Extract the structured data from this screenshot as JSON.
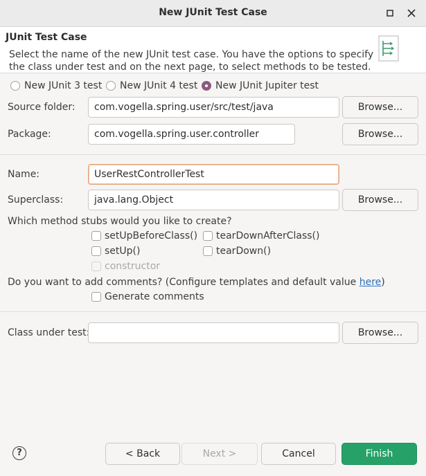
{
  "window": {
    "title": "New JUnit Test Case",
    "minimize_icon": "minimize-icon",
    "close_icon": "close-icon"
  },
  "header": {
    "title": "JUnit Test Case",
    "description_line1": "Select the name of the new JUnit test case. You have the options to specify",
    "description_line2": "the class under test and on the next page, to select methods to be tested.",
    "icon": "junit-wizard-icon"
  },
  "junit_version": {
    "options": [
      {
        "label": "New JUnit 3 test",
        "selected": false
      },
      {
        "label": "New JUnit 4 test",
        "selected": false
      },
      {
        "label": "New JUnit Jupiter test",
        "selected": true
      }
    ]
  },
  "source_folder": {
    "label": "Source folder:",
    "value": "com.vogella.spring.user/src/test/java",
    "browse_label": "Browse..."
  },
  "package": {
    "label": "Package:",
    "value": "com.vogella.spring.user.controller",
    "browse_label": "Browse..."
  },
  "name": {
    "label": "Name:",
    "value": "UserRestControllerTest"
  },
  "superclass": {
    "label": "Superclass:",
    "value": "java.lang.Object",
    "browse_label": "Browse..."
  },
  "method_stubs": {
    "question": "Which method stubs would you like to create?",
    "options": [
      {
        "label": "setUpBeforeClass()",
        "checked": false,
        "enabled": true
      },
      {
        "label": "tearDownAfterClass()",
        "checked": false,
        "enabled": true
      },
      {
        "label": "setUp()",
        "checked": false,
        "enabled": true
      },
      {
        "label": "tearDown()",
        "checked": false,
        "enabled": true
      },
      {
        "label": "constructor",
        "checked": false,
        "enabled": false
      }
    ]
  },
  "comments": {
    "question_prefix": "Do you want to add comments? (Configure templates and default value ",
    "link_text": "here",
    "question_suffix": ")",
    "generate_label": "Generate comments",
    "generate_checked": false
  },
  "class_under_test": {
    "label": "Class under test:",
    "value": "",
    "browse_label": "Browse..."
  },
  "footer": {
    "help_icon": "help-icon",
    "help_glyph": "?",
    "back_label": "< Back",
    "next_label": "Next >",
    "cancel_label": "Cancel",
    "finish_label": "Finish",
    "finish_color": "#26a269"
  }
}
